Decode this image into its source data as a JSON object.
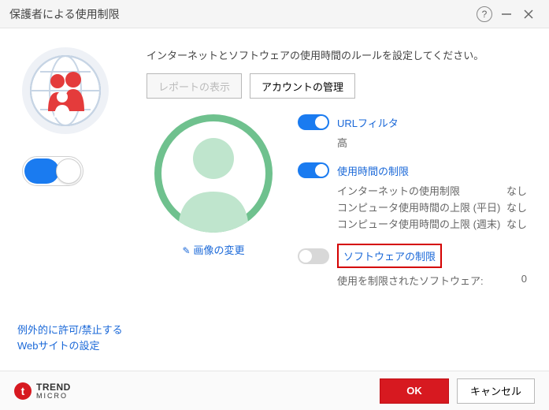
{
  "titlebar": {
    "title": "保護者による使用制限"
  },
  "intro": "インターネットとソフトウェアの使用時間のルールを設定してください。",
  "buttons": {
    "view_report": "レポートの表示",
    "manage_accounts": "アカウントの管理"
  },
  "avatar": {
    "change_label": "画像の変更"
  },
  "settings": {
    "url_filter": {
      "label": "URLフィルタ",
      "level": "高"
    },
    "time_limit": {
      "label": "使用時間の制限",
      "rows": [
        {
          "label": "インターネットの使用制限",
          "value": "なし"
        },
        {
          "label": "コンピュータ使用時間の上限 (平日)",
          "value": "なし"
        },
        {
          "label": "コンピュータ使用時間の上限 (週末)",
          "value": "なし"
        }
      ]
    },
    "software_limit": {
      "label": "ソフトウェアの制限",
      "rows": [
        {
          "label": "使用を制限されたソフトウェア:",
          "value": "0"
        }
      ]
    }
  },
  "exception_link": {
    "line1": "例外的に許可/禁止する",
    "line2": "Webサイトの設定"
  },
  "brand": {
    "name": "TREND",
    "sub": "MICRO"
  },
  "footer": {
    "ok": "OK",
    "cancel": "キャンセル"
  }
}
